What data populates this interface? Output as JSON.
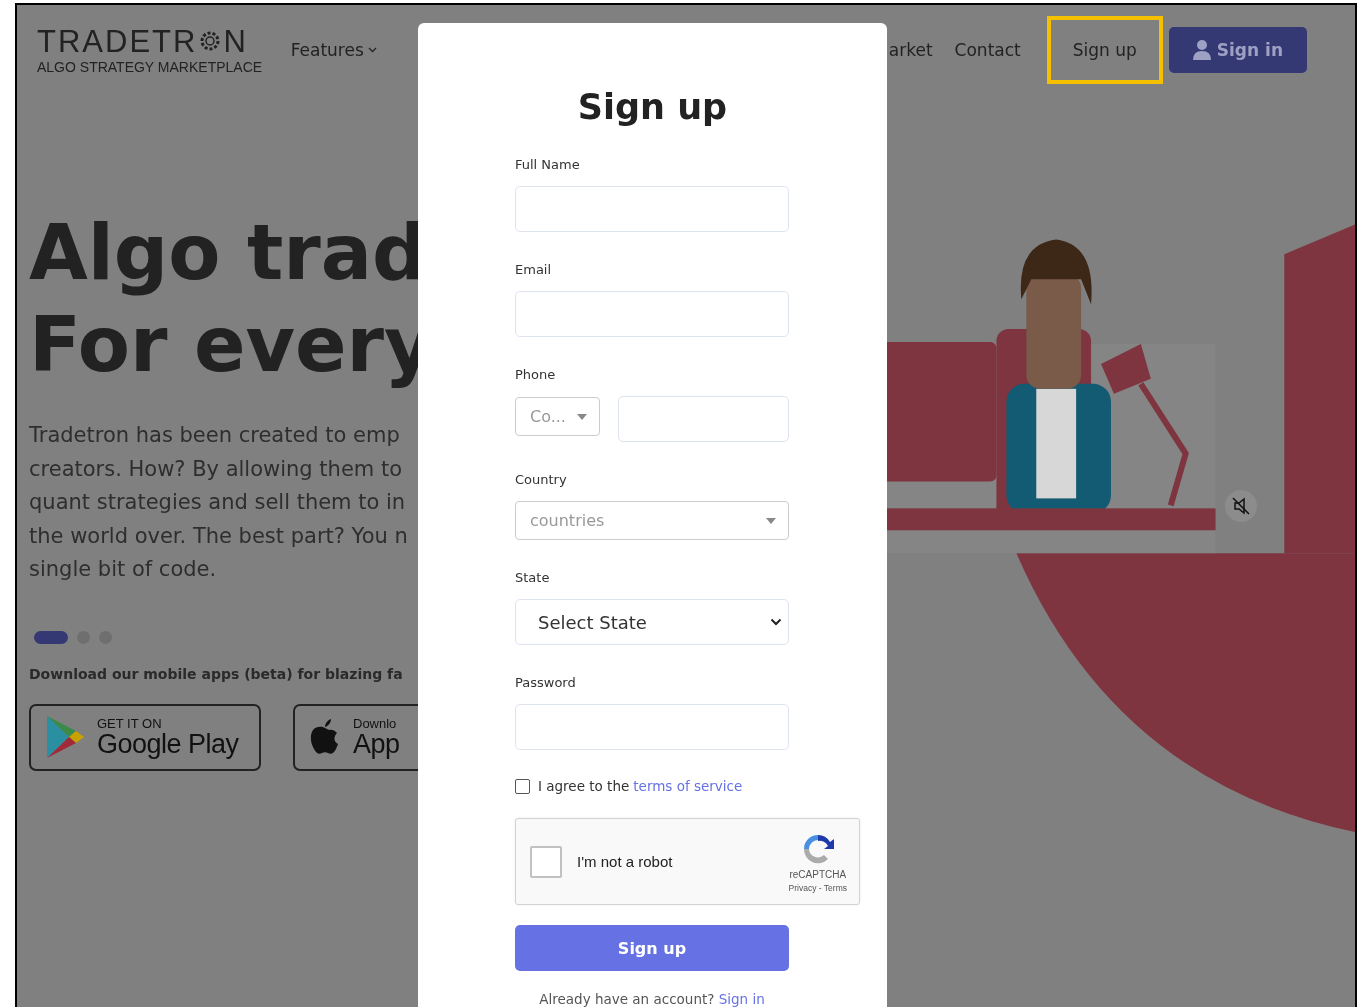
{
  "header": {
    "logo": {
      "before": "TRADETR",
      "after": "N",
      "tagline": "ALGO STRATEGY MARKETPLACE"
    },
    "nav": [
      {
        "label": "Features",
        "kind": "dropdown",
        "highlighted": false
      },
      {
        "label": "arket",
        "kind": "link",
        "highlighted": false
      },
      {
        "label": "Contact",
        "kind": "link",
        "highlighted": false
      },
      {
        "label": "Sign up",
        "kind": "link",
        "highlighted": true
      }
    ],
    "signin_button": "Sign in"
  },
  "hero": {
    "heading_lines": [
      "Algo trad",
      "For every"
    ],
    "paragraph_lines": [
      "Tradetron has been created to emp",
      "creators. How? By allowing them to",
      "quant strategies and sell them to in",
      "the world over. The best part? You n",
      "single bit of code."
    ],
    "carousel_dots": [
      {
        "selected": true
      },
      {
        "selected": false
      },
      {
        "selected": false
      }
    ],
    "apps_text": "Download our mobile apps (beta) for blazing fa",
    "store_badges": [
      {
        "kind": "google",
        "small": "GET IT ON",
        "big": "Google Play"
      },
      {
        "kind": "apple",
        "small": "Downlo",
        "big": "App"
      }
    ],
    "illustration": {
      "kind": "picture"
    }
  },
  "modal": {
    "title": "Sign up",
    "fields": [
      {
        "label": "Full Name",
        "kind": "text"
      },
      {
        "label": "Email",
        "kind": "text"
      },
      {
        "label": "Phone",
        "kind": "phone",
        "code_placeholder": "Co..."
      },
      {
        "label": "Country",
        "kind": "combo",
        "placeholder": "countries"
      },
      {
        "label": "State",
        "kind": "select",
        "value": "Select State"
      },
      {
        "label": "Password",
        "kind": "password"
      }
    ],
    "terms": {
      "checked": false,
      "text": "I agree to the",
      "link": "terms of service"
    },
    "captcha": {
      "checked": false,
      "label": "I'm not a robot",
      "brand": "reCAPTCHA",
      "links": "Privacy - Terms"
    },
    "submit": "Sign up",
    "footer": {
      "text": "Already have an account?",
      "link": "Sign in"
    }
  }
}
